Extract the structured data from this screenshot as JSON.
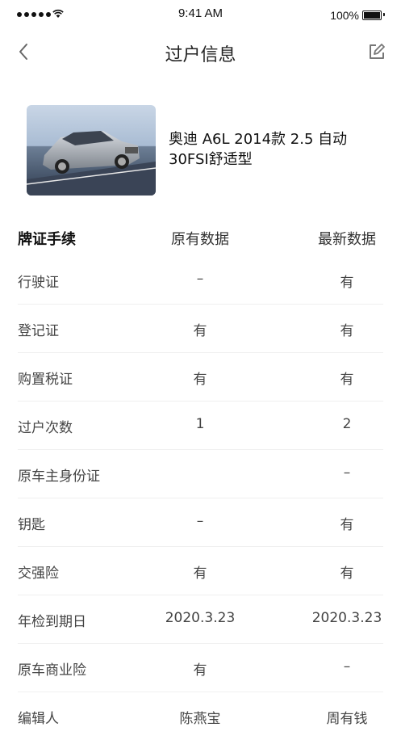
{
  "status_bar": {
    "time": "9:41 AM",
    "battery": "100%"
  },
  "nav": {
    "title": "过户信息"
  },
  "car": {
    "name": "奥迪 A6L 2014款 2.5 自动 30FSI舒适型"
  },
  "table": {
    "headers": [
      "牌证手续",
      "原有数据",
      "最新数据"
    ],
    "rows": [
      {
        "label": "行驶证",
        "original": "–",
        "latest": "有"
      },
      {
        "label": "登记证",
        "original": "有",
        "latest": "有"
      },
      {
        "label": "购置税证",
        "original": "有",
        "latest": "有"
      },
      {
        "label": "过户次数",
        "original": "1",
        "latest": "2"
      },
      {
        "label": "原车主身份证",
        "original": "",
        "latest": "–"
      },
      {
        "label": "钥匙",
        "original": "–",
        "latest": "有"
      },
      {
        "label": "交强险",
        "original": "有",
        "latest": "有"
      },
      {
        "label": "年检到期日",
        "original": "2020.3.23",
        "latest": "2020.3.23"
      },
      {
        "label": "原车商业险",
        "original": "有",
        "latest": "–"
      },
      {
        "label": "编辑人",
        "original": "陈燕宝",
        "latest": "周有钱"
      }
    ]
  }
}
